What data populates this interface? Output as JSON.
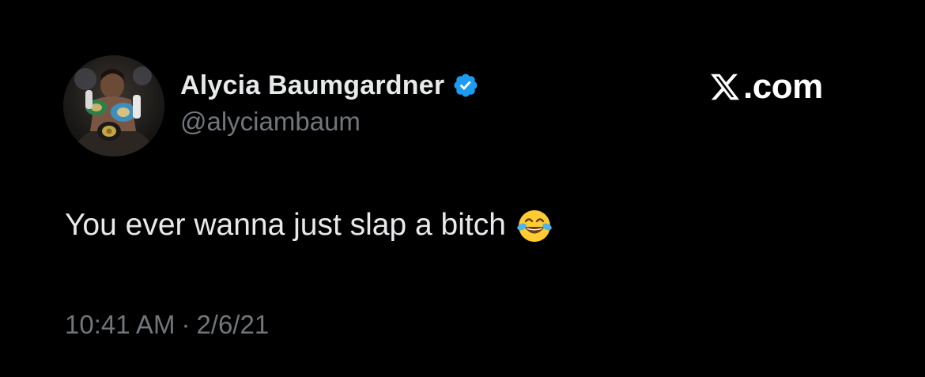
{
  "tweet": {
    "author": {
      "display_name": "Alycia Baumgardner",
      "handle": "@alyciambaum",
      "verified_icon": "verified-badge-icon",
      "avatar_icon": "avatar-photo"
    },
    "brand": {
      "logo_icon": "x-logo-icon",
      "text": ".com"
    },
    "body": {
      "text": "You ever wanna just slap a bitch",
      "emoji": "face-with-tears-of-joy-icon"
    },
    "meta": {
      "time": "10:41 AM",
      "separator": "·",
      "date": "2/6/21"
    }
  },
  "colors": {
    "background": "#000000",
    "primary_text": "#e7e9ea",
    "secondary_text": "#71767b",
    "verified_blue": "#1d9bf0",
    "brand_white": "#ffffff"
  }
}
